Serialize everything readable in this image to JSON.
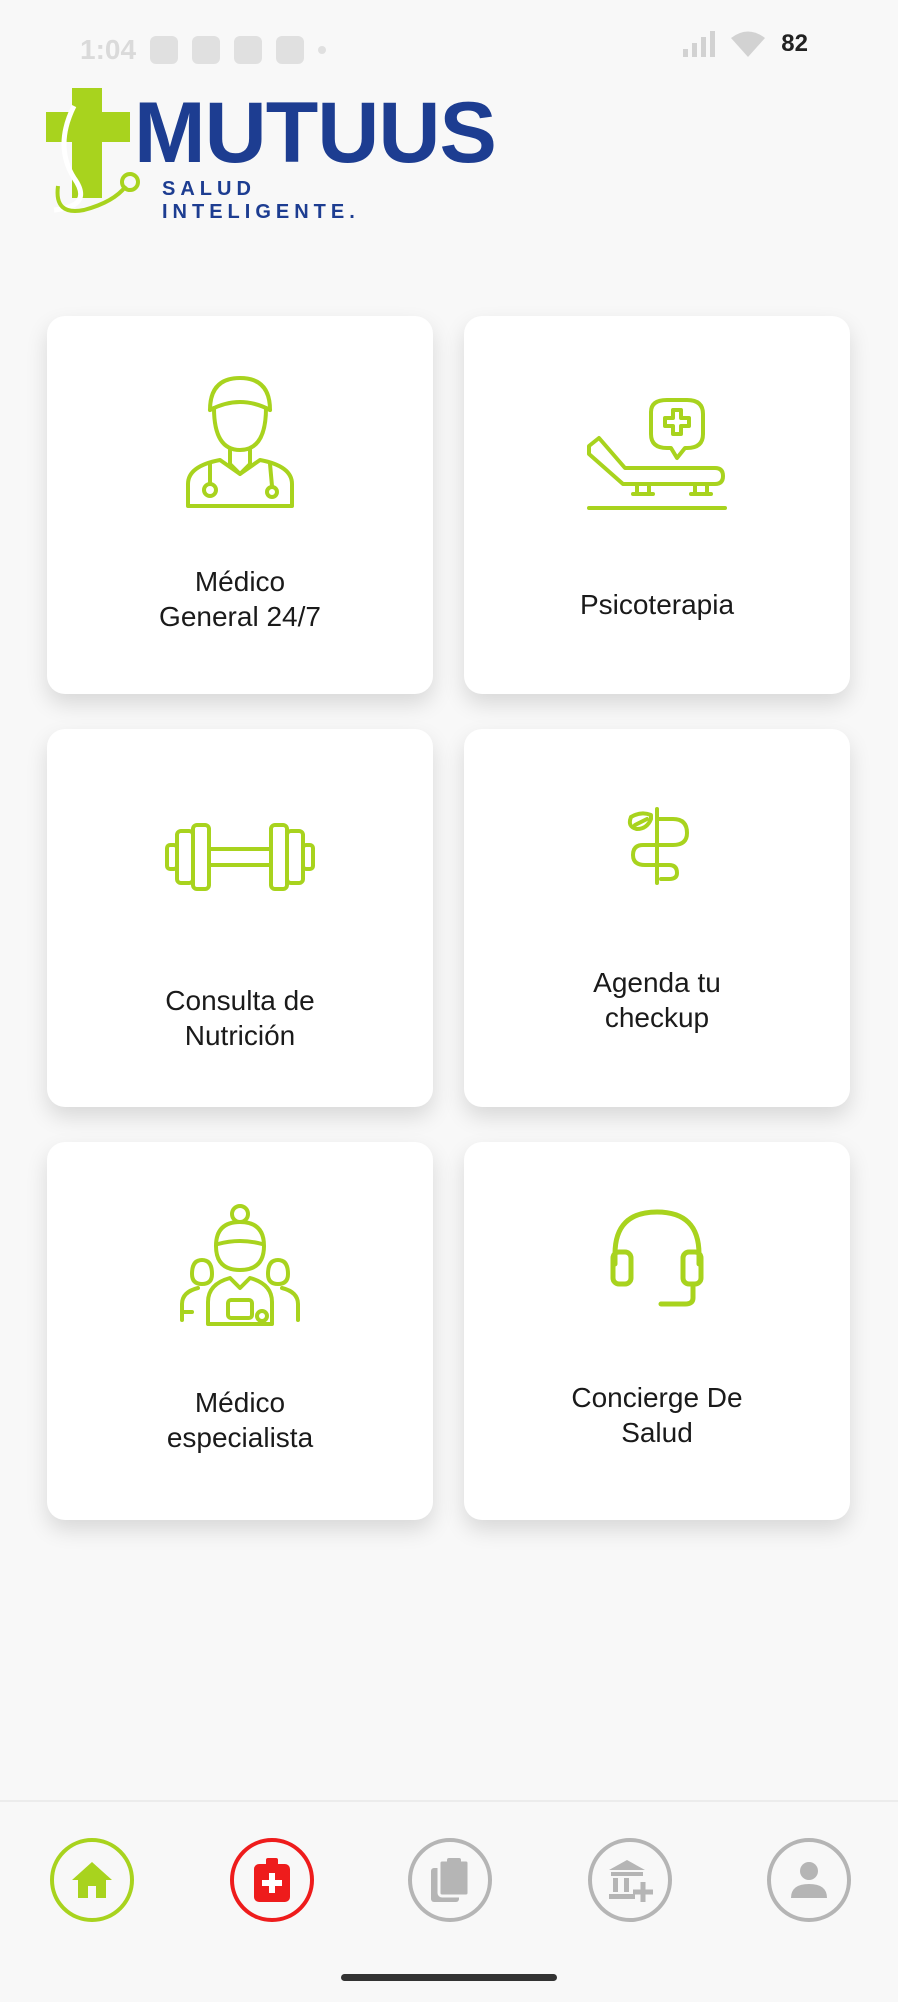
{
  "status_bar": {
    "time": "1:04",
    "battery": "82"
  },
  "logo": {
    "word": "MUTUUS",
    "tagline": "SALUD INTELIGENTE."
  },
  "colors": {
    "accent_green": "#a8d31e",
    "brand_blue": "#1d3d91",
    "emergency_red": "#ee1c1c",
    "inactive_gray": "#b5b5b5"
  },
  "services": [
    {
      "label": "Médico\nGeneral 24/7",
      "icon": "doctor-icon"
    },
    {
      "label": "Psicoterapia",
      "icon": "therapy-couch-icon"
    },
    {
      "label": "Consulta de\nNutrición",
      "icon": "dumbbell-icon"
    },
    {
      "label": "Agenda tu\ncheckup",
      "icon": "caduceus-icon"
    },
    {
      "label": "Médico\nespecialista",
      "icon": "specialists-icon"
    },
    {
      "label": "Concierge De\nSalud",
      "icon": "headset-icon"
    }
  ],
  "nav": {
    "items": [
      {
        "icon": "home-icon",
        "active": true
      },
      {
        "icon": "medical-bag-icon",
        "active": false
      },
      {
        "icon": "clipboard-icon",
        "active": false
      },
      {
        "icon": "hospital-icon",
        "active": false
      },
      {
        "icon": "user-icon",
        "active": false
      }
    ]
  }
}
